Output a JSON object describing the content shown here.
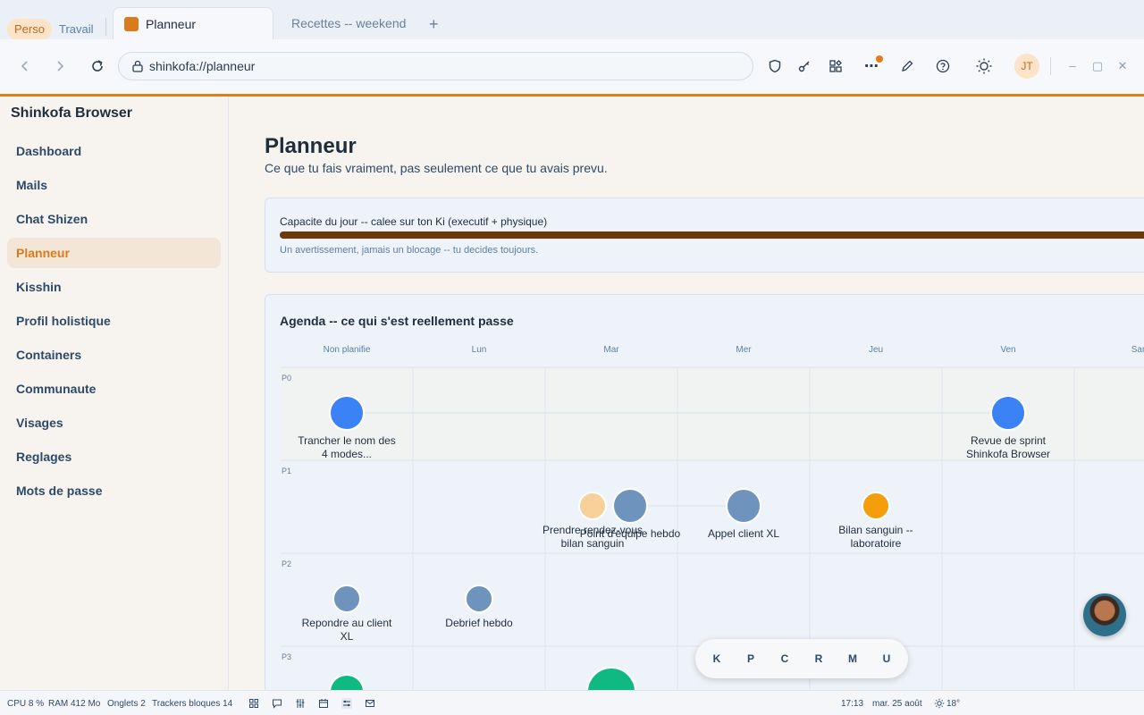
{
  "tabbar": {
    "profiles": [
      "Perso",
      "Travail"
    ],
    "tabs": [
      {
        "label": "Planneur",
        "active": true
      },
      {
        "label": "Recettes -- weekend",
        "active": false
      }
    ],
    "new_tab": "+"
  },
  "toolbar": {
    "url": "shinkofa://planneur",
    "avatar_initials": "JT",
    "icons": [
      "shield-icon",
      "key-icon",
      "puzzle-icon",
      "more-icon",
      "pen-icon",
      "help-icon",
      "sun-icon"
    ]
  },
  "sidebar": {
    "brand": "Shinkofa Browser",
    "items": [
      {
        "label": "Dashboard"
      },
      {
        "label": "Mails"
      },
      {
        "label": "Chat Shizen"
      },
      {
        "label": "Planneur",
        "active": true
      },
      {
        "label": "Kisshin"
      },
      {
        "label": "Profil holistique"
      },
      {
        "label": "Containers"
      },
      {
        "label": "Communaute"
      },
      {
        "label": "Visages"
      },
      {
        "label": "Reglages"
      },
      {
        "label": "Mots de passe"
      }
    ]
  },
  "page": {
    "title": "Planneur",
    "subtitle": "Ce que tu fais vraiment, pas seulement ce que tu avais prevu."
  },
  "capacity": {
    "title": "Capacite du jour -- calee sur ton Ki (executif + physique)",
    "note": "Un avertissement, jamais un blocage -- tu decides toujours.",
    "fill_fraction": 1.0
  },
  "agenda": {
    "title": "Agenda -- ce qui s'est reellement passe",
    "columns": [
      "Non planifie",
      "Lun",
      "Mar",
      "Mer",
      "Jeu",
      "Ven",
      "Sam"
    ],
    "rows": [
      "P0",
      "P1",
      "P2",
      "P3"
    ],
    "colors": {
      "blue": "#3b82f6",
      "slate": "#6e93bd",
      "orange": "#f59e0b",
      "peach": "#f6d29a",
      "green": "#10b981"
    },
    "events": [
      {
        "label": "Trancher le nom des 4 modes...",
        "col": 0,
        "row": 0,
        "color": "blue",
        "size": "l"
      },
      {
        "label": "Revue de sprint Shinkofa Browser",
        "col": 5,
        "row": 0,
        "color": "blue",
        "size": "l"
      },
      {
        "label": "Prendre rendez-vous bilan sanguin",
        "col": 2,
        "row": 1,
        "color": "peach",
        "size": "m",
        "shift": -21
      },
      {
        "label": "Point d'equipe hebdo",
        "col": 2,
        "row": 1,
        "color": "slate",
        "size": "l",
        "shift": 21
      },
      {
        "label": "Appel client XL",
        "col": 3,
        "row": 1,
        "color": "slate",
        "size": "l"
      },
      {
        "label": "Bilan sanguin -- laboratoire",
        "col": 4,
        "row": 1,
        "color": "orange",
        "size": "m"
      },
      {
        "label": "Repondre au client XL",
        "col": 0,
        "row": 2,
        "color": "slate",
        "size": "m"
      },
      {
        "label": "Debrief hebdo",
        "col": 1,
        "row": 2,
        "color": "slate",
        "size": "m"
      },
      {
        "label": "",
        "col": 0,
        "row": 3,
        "color": "green",
        "size": "l"
      },
      {
        "label": "",
        "col": 2,
        "row": 3,
        "color": "green",
        "size": "xl"
      }
    ],
    "links": [
      {
        "from": 0,
        "to": 1
      },
      {
        "from": 3,
        "to": 4
      }
    ]
  },
  "keypad": {
    "keys": [
      "K",
      "P",
      "C",
      "R",
      "M",
      "U"
    ]
  },
  "statusbar": {
    "cpu": "CPU 8 %",
    "ram": "RAM 412 Mo",
    "tabs": "Onglets 2",
    "trackers": "Trackers bloques 14",
    "time": "17:13",
    "date": "mar. 25 août",
    "weather": "18°"
  }
}
